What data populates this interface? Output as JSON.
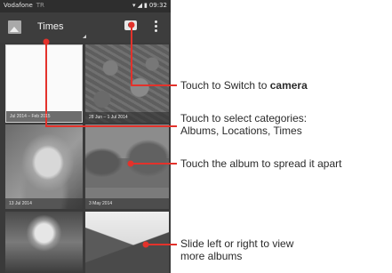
{
  "status_bar": {
    "carrier": "Vodafone",
    "carrier_sub": "TR",
    "time": "09:32",
    "wifi_icon": "wifi-icon",
    "signal_icon": "signal-icon",
    "battery_icon": "battery-icon"
  },
  "action_bar": {
    "app_icon": "gallery-icon",
    "view_title": "Times",
    "camera_icon": "camera-icon",
    "overflow_icon": "overflow-menu-icon"
  },
  "albums": [
    {
      "label": "Jul 2014 – Feb 2015"
    },
    {
      "label": "28 Jun – 1 Jul 2014"
    },
    {
      "label": "13 Jul 2014"
    },
    {
      "label": "3 May 2014"
    },
    {
      "label": ""
    },
    {
      "label": ""
    }
  ],
  "callouts": {
    "camera": {
      "text": "Touch to Switch to ",
      "bold": "camera"
    },
    "categories": {
      "line1": "Touch to select categories:",
      "line2": "Albums, Locations, Times"
    },
    "spread": {
      "text": "Touch the album to spread it apart"
    },
    "slide": {
      "line1": "Slide left or right to view",
      "line2": "more albums"
    }
  },
  "colors": {
    "callout_line": "#e3322b",
    "action_bar": "#3d3d3d",
    "status_bar": "#2e2e2e"
  }
}
